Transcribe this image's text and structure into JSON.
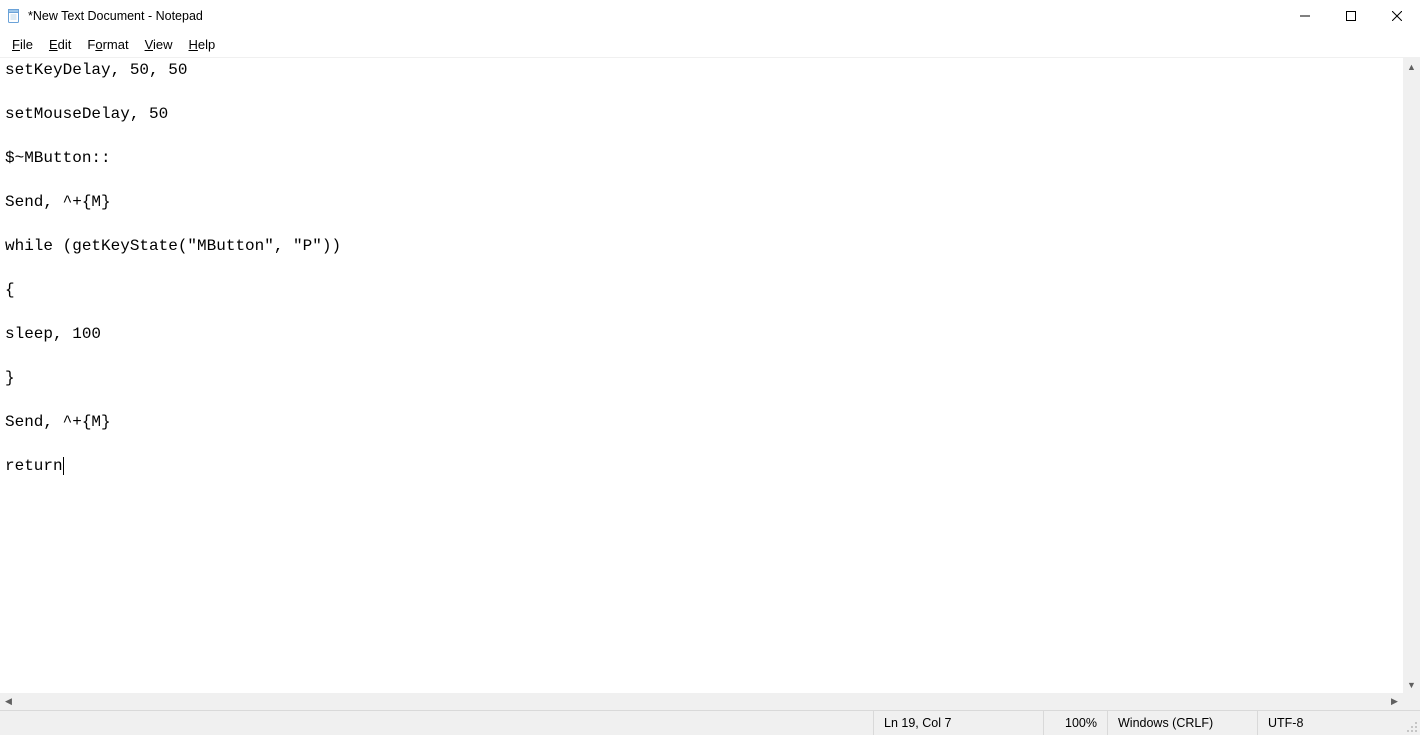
{
  "window": {
    "title": "*New Text Document - Notepad"
  },
  "menus": {
    "file": {
      "u": "F",
      "rest": "ile"
    },
    "edit": {
      "u": "E",
      "rest": "dit"
    },
    "format": {
      "pre": "F",
      "u": "o",
      "rest": "rmat"
    },
    "view": {
      "u": "V",
      "rest": "iew"
    },
    "help": {
      "u": "H",
      "rest": "elp"
    }
  },
  "editor": {
    "content": "setKeyDelay, 50, 50\n\nsetMouseDelay, 50\n\n$~MButton::\n\nSend, ^+{M}\n\nwhile (getKeyState(\"MButton\", \"P\"))\n\n{\n\nsleep, 100\n\n}\n\nSend, ^+{M}\n\nreturn"
  },
  "status": {
    "position": "Ln 19, Col 7",
    "zoom": "100%",
    "eol": "Windows (CRLF)",
    "encoding": "UTF-8"
  }
}
